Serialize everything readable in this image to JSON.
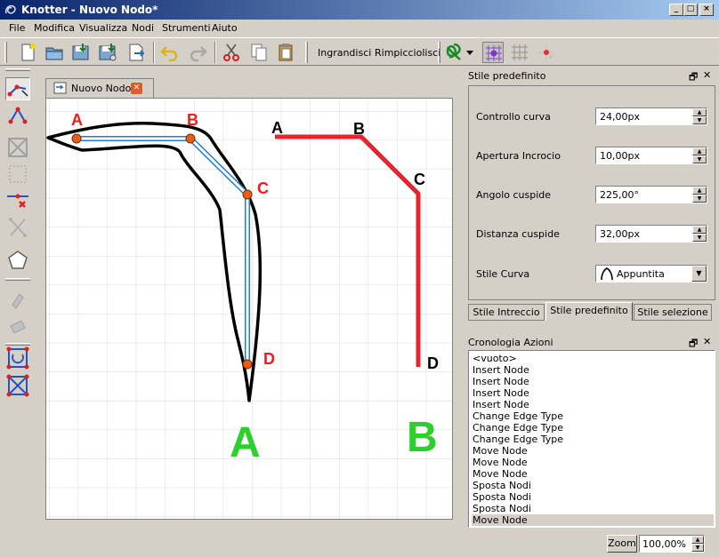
{
  "window": {
    "title": "Knotter - Nuovo Nodo*",
    "controls": [
      "_",
      "□",
      "×"
    ]
  },
  "menu": [
    "File",
    "Modifica",
    "Visualizza",
    "Nodi",
    "Strumenti",
    "Aiuto"
  ],
  "toolbar": {
    "zoom_in_label": "Ingrandisci",
    "zoom_out_label": "Rimpicciolisci"
  },
  "tab": {
    "label": "Nuovo Nodo"
  },
  "canvas": {
    "left_labels": [
      "A",
      "B",
      "C",
      "D"
    ],
    "right_labels": [
      "A",
      "B",
      "C",
      "D"
    ],
    "caption_left": "A",
    "caption_right": "B",
    "colors": {
      "node_label": "#ee1c1c",
      "caption": "#29d12a",
      "edge_red": "#e8232e",
      "edge_blue": "#1e7fd0",
      "node_fill": "#f05a14"
    }
  },
  "style_panel": {
    "title": "Stile predefinito",
    "fields": [
      {
        "label": "Controllo curva",
        "value": "24,00px"
      },
      {
        "label": "Apertura Incrocio",
        "value": "10,00px"
      },
      {
        "label": "Angolo cuspide",
        "value": "225,00°"
      },
      {
        "label": "Distanza cuspide",
        "value": "32,00px"
      }
    ],
    "curve_style": {
      "label": "Stile Curva",
      "value": "Appuntita"
    },
    "tabs": [
      "Stile Intreccio",
      "Stile predefinito",
      "Stile selezione"
    ],
    "active_tab": "Stile predefinito"
  },
  "history_panel": {
    "title": "Cronologia Azioni",
    "items": [
      "<vuoto>",
      "Insert Node",
      "Insert Node",
      "Insert Node",
      "Insert Node",
      "Change Edge Type",
      "Change Edge Type",
      "Change Edge Type",
      "Move Node",
      "Move Node",
      "Move Node",
      "Sposta Nodi",
      "Sposta Nodi",
      "Sposta Nodi",
      "Move Node"
    ],
    "selected_index": 14
  },
  "dock_buttons": {
    "float": "🗗",
    "close": "✕"
  },
  "status": {
    "zoom_label": "Zoom",
    "zoom_value": "100,00%"
  }
}
